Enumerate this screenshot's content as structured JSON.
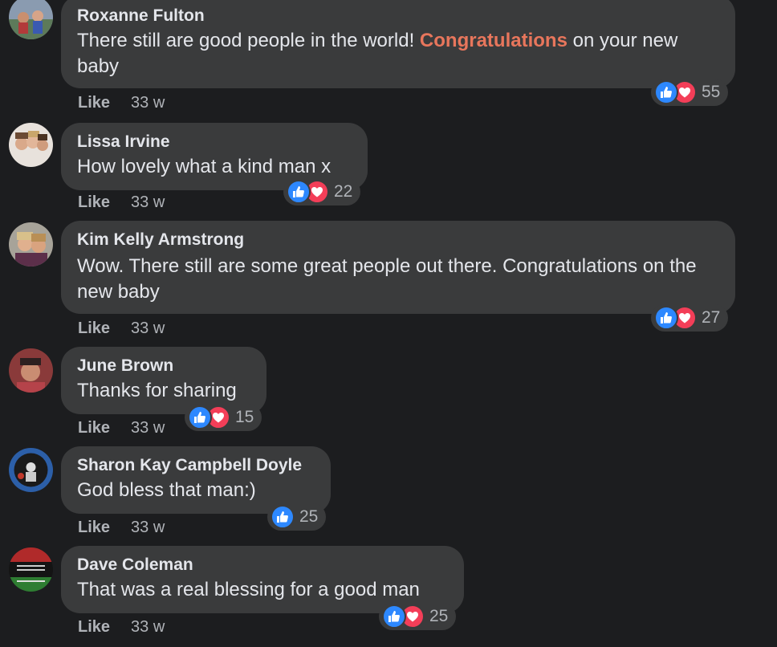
{
  "comments": [
    {
      "author": "Roxanne Fulton",
      "text_before": "There still are good people in the world! ",
      "text_highlight": "Congratulations",
      "text_after": " on your new baby",
      "like_label": "Like",
      "time": "33 w",
      "reaction_count": "55",
      "reactions": [
        "like",
        "love"
      ]
    },
    {
      "author": "Lissa Irvine",
      "text": "How lovely what a kind man x",
      "like_label": "Like",
      "time": "33 w",
      "reaction_count": "22",
      "reactions": [
        "like",
        "love"
      ]
    },
    {
      "author": "Kim Kelly Armstrong",
      "text": "Wow. There still are some great people out there. Congratulations on the new baby",
      "like_label": "Like",
      "time": "33 w",
      "reaction_count": "27",
      "reactions": [
        "like",
        "love"
      ]
    },
    {
      "author": "June Brown",
      "text": "Thanks for sharing",
      "like_label": "Like",
      "time": "33 w",
      "reaction_count": "15",
      "reactions": [
        "like",
        "love"
      ]
    },
    {
      "author": "Sharon Kay Campbell Doyle",
      "text": "God bless that man:)",
      "like_label": "Like",
      "time": "33 w",
      "reaction_count": "25",
      "reactions": [
        "like"
      ]
    },
    {
      "author": "Dave Coleman",
      "text": "That was a real blessing for a good man",
      "like_label": "Like",
      "time": "33 w",
      "reaction_count": "25",
      "reactions": [
        "like",
        "love"
      ]
    }
  ],
  "colors": {
    "background": "#1c1d1f",
    "bubble": "#3a3b3c",
    "text": "#e4e6eb",
    "muted": "#b0b3b8",
    "highlight": "#e8765c",
    "like": "#2d88ff",
    "love": "#f33e58"
  }
}
